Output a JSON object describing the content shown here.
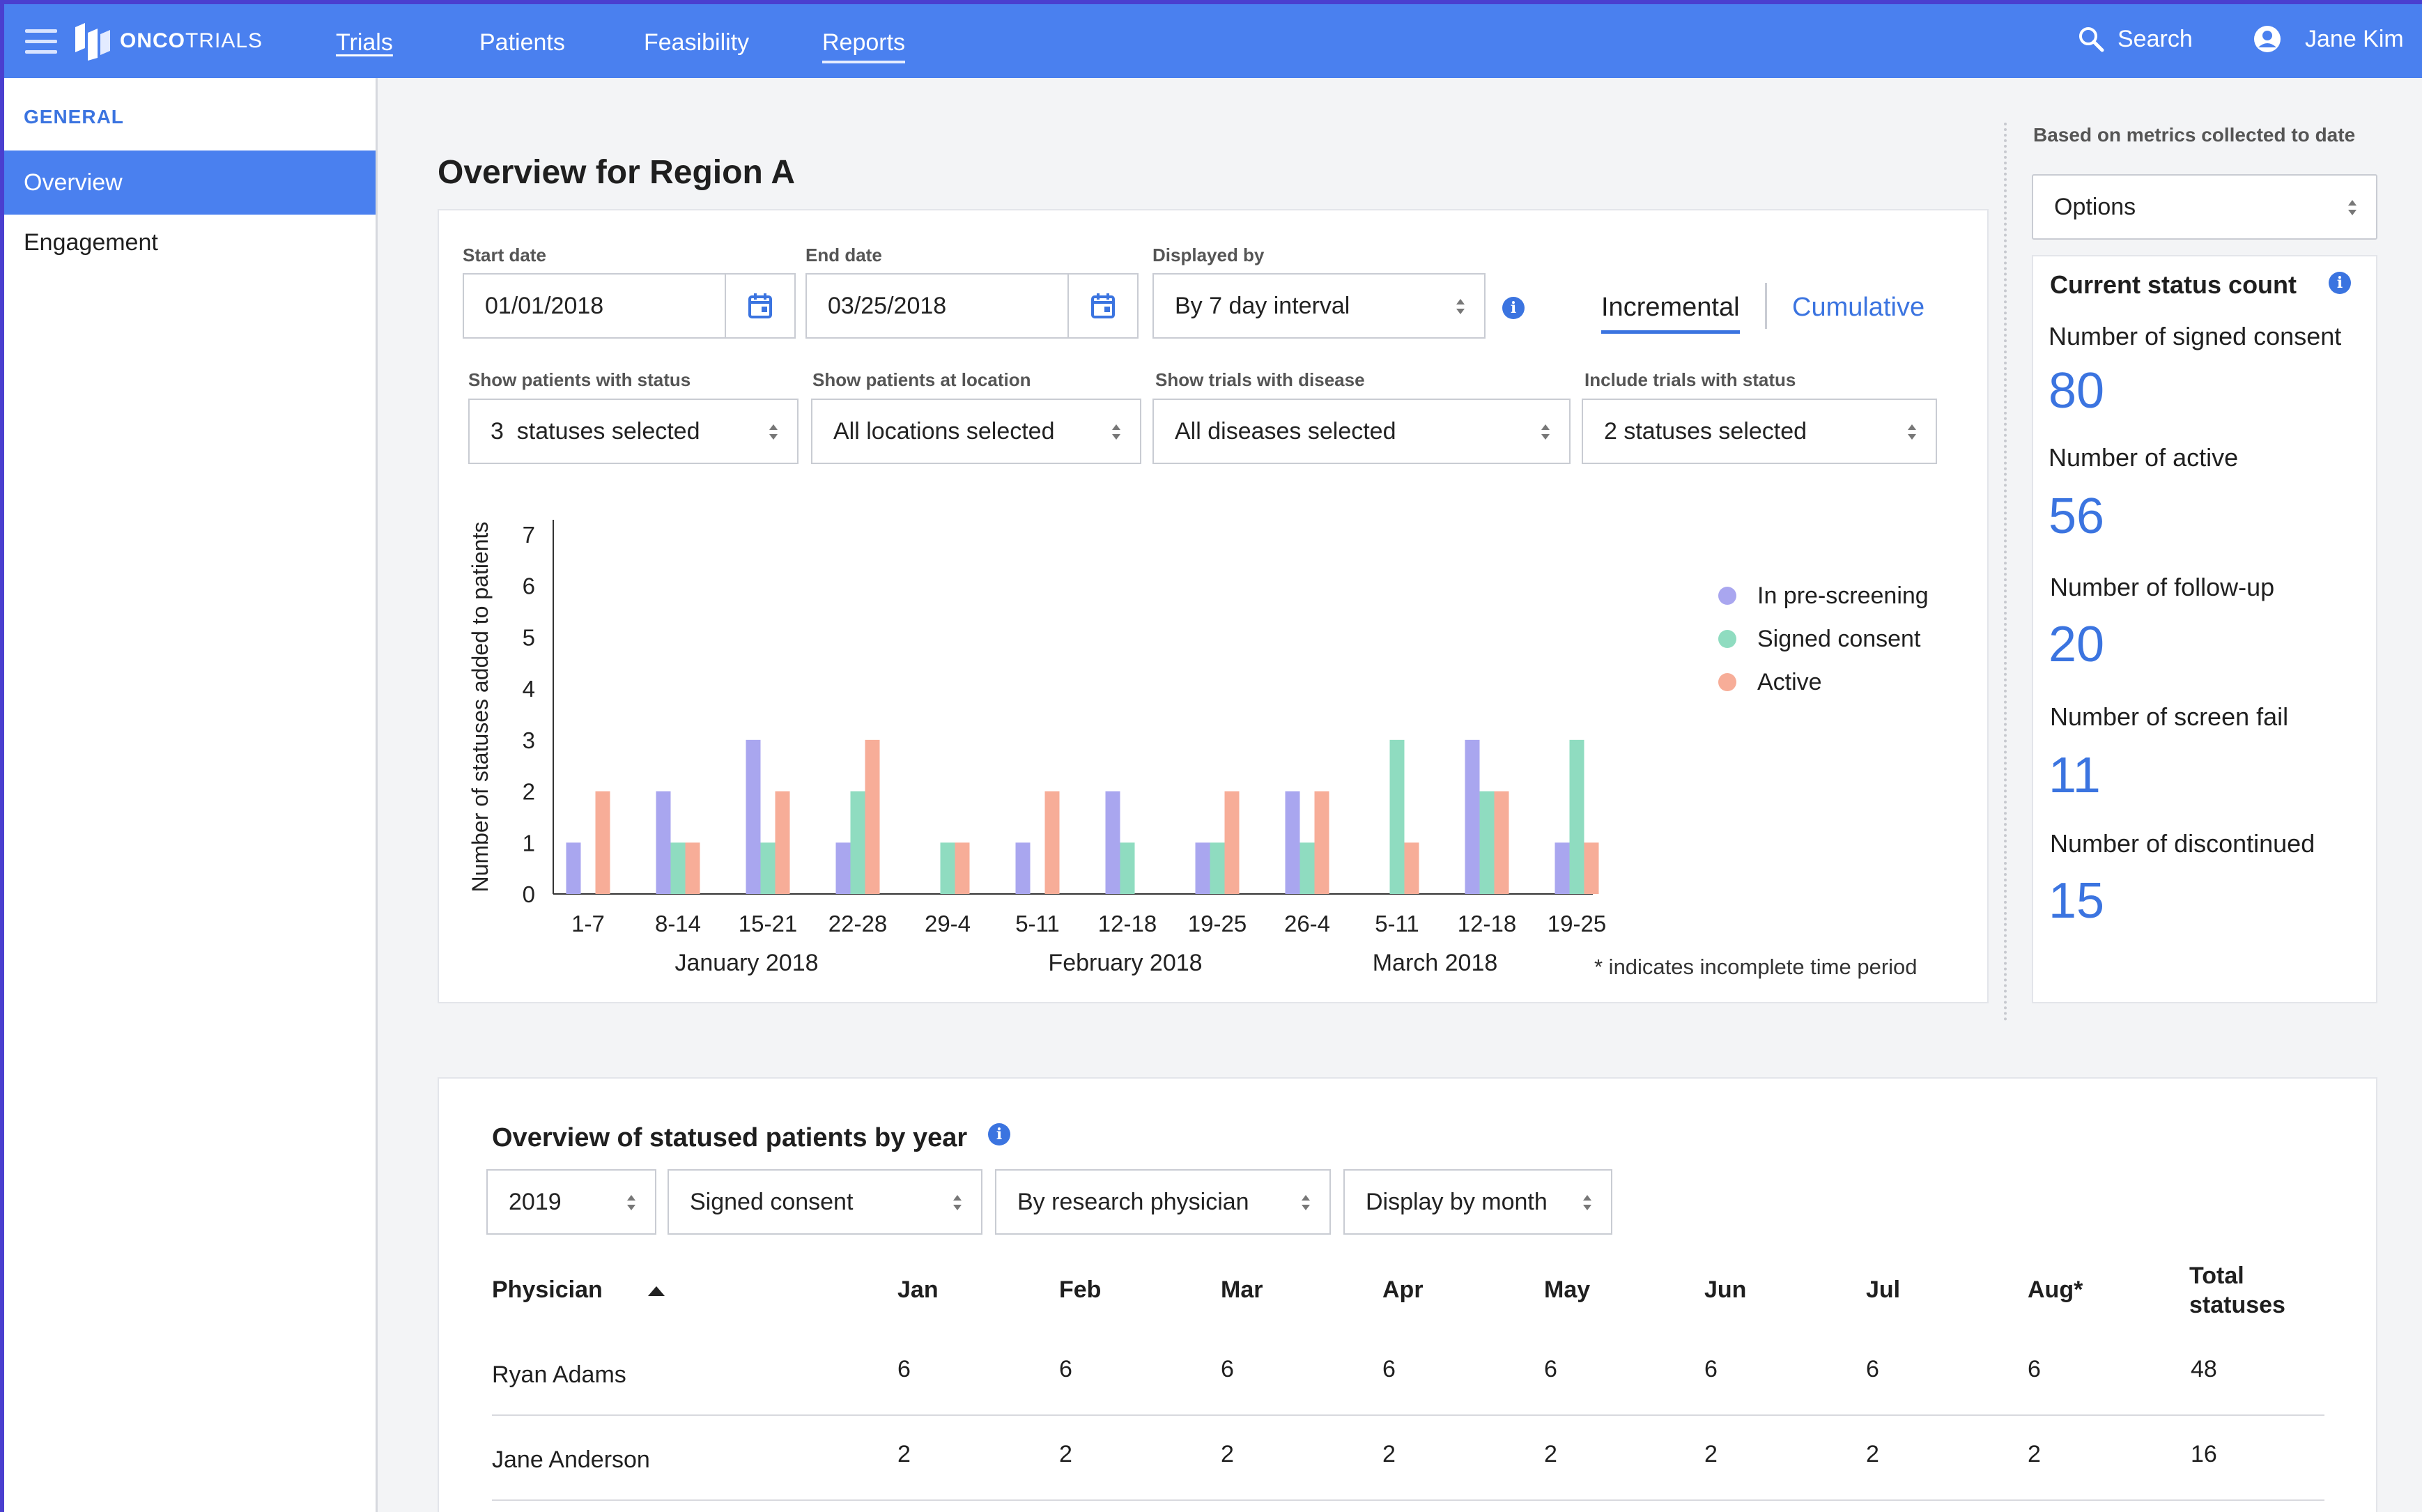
{
  "brand": {
    "name_bold": "ONCO",
    "name_light": "TRIALS"
  },
  "nav": {
    "trials": "Trials",
    "patients": "Patients",
    "feasibility": "Feasibility",
    "reports": "Reports"
  },
  "header": {
    "search": "Search",
    "user": "Jane Kim"
  },
  "sidebar": {
    "section": "GENERAL",
    "items": [
      {
        "label": "Overview"
      },
      {
        "label": "Engagement"
      }
    ]
  },
  "page": {
    "title": "Overview for Region A"
  },
  "filters": {
    "start_date_label": "Start date",
    "start_date": "01/01/2018",
    "end_date_label": "End date",
    "end_date": "03/25/2018",
    "displayed_by_label": "Displayed by",
    "displayed_by": "By 7 day interval",
    "incremental": "Incremental",
    "cumulative": "Cumulative",
    "patient_status_label": "Show patients with status",
    "patient_status": "3  statuses selected",
    "location_label": "Show patients at location",
    "location": "All locations selected",
    "disease_label": "Show trials with disease",
    "disease": "All diseases selected",
    "trial_status_label": "Include trials with status",
    "trial_status": "2 statuses selected"
  },
  "chart_data": {
    "type": "bar",
    "ylabel": "Number of statuses added to patients",
    "ylim": [
      0,
      7
    ],
    "yticks": [
      0,
      1,
      2,
      3,
      4,
      5,
      6,
      7
    ],
    "categories": [
      "1-7",
      "8-14",
      "15-21",
      "22-28",
      "29-4",
      "5-11",
      "12-18",
      "19-25",
      "26-4",
      "5-11",
      "12-18",
      "19-25"
    ],
    "month_labels": [
      "January 2018",
      "February 2018",
      "March 2018"
    ],
    "series": [
      {
        "name": "In pre-screening",
        "color": "#a9a6ef",
        "values": [
          1,
          2,
          3,
          1,
          0,
          1,
          2,
          1,
          2,
          0,
          3,
          1
        ]
      },
      {
        "name": "Signed consent",
        "color": "#8fdcc0",
        "values": [
          0,
          1,
          1,
          2,
          1,
          0,
          1,
          1,
          1,
          3,
          2,
          3
        ]
      },
      {
        "name": "Active",
        "color": "#f7ad98",
        "values": [
          2,
          1,
          2,
          3,
          1,
          2,
          0,
          2,
          2,
          1,
          2,
          1
        ]
      }
    ],
    "footnote": "* indicates incomplete time period"
  },
  "right_panel": {
    "note": "Based on metrics collected to date",
    "options": "Options",
    "title": "Current status count",
    "stats": [
      {
        "label": "Number of signed consent",
        "value": "80"
      },
      {
        "label": "Number of active",
        "value": "56"
      },
      {
        "label": "Number of follow-up",
        "value": "20"
      },
      {
        "label": "Number of screen fail",
        "value": "11"
      },
      {
        "label": "Number of discontinued",
        "value": "15"
      }
    ]
  },
  "table_section": {
    "title": "Overview of statused patients by year",
    "selects": [
      "2019",
      "Signed consent",
      "By research physician",
      "Display by month"
    ],
    "headers": [
      "Physician",
      "Jan",
      "Feb",
      "Mar",
      "Apr",
      "May",
      "Jun",
      "Jul",
      "Aug*",
      "Total",
      "statuses"
    ],
    "rows": [
      {
        "name": "Ryan Adams",
        "values": [
          "6",
          "6",
          "6",
          "6",
          "6",
          "6",
          "6",
          "6",
          "48"
        ]
      },
      {
        "name": "Jane Anderson",
        "values": [
          "2",
          "2",
          "2",
          "2",
          "2",
          "2",
          "2",
          "2",
          "16"
        ]
      }
    ]
  },
  "colors": {
    "brand_blue": "#4a80ef",
    "accent_blue": "#3b74e0"
  }
}
